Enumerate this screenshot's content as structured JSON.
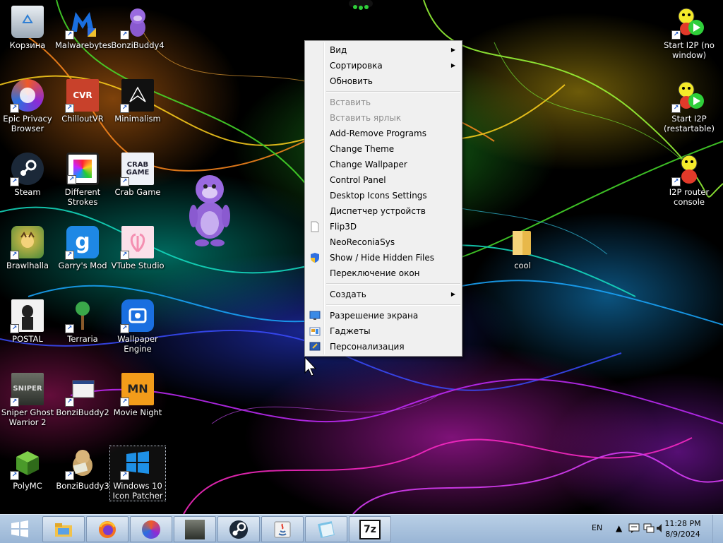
{
  "desktop_icons": [
    {
      "label": "Корзина"
    },
    {
      "label": "Malwarebytes"
    },
    {
      "label": "BonziBuddy4"
    },
    {
      "label": "Epic Privacy Browser"
    },
    {
      "label": "ChilloutVR"
    },
    {
      "label": "Minimalism"
    },
    {
      "label": "Steam"
    },
    {
      "label": "Different Strokes"
    },
    {
      "label": "Crab Game"
    },
    {
      "label": "Brawlhalla"
    },
    {
      "label": "Garry's Mod"
    },
    {
      "label": "VTube Studio"
    },
    {
      "label": "POSTAL"
    },
    {
      "label": "Terraria"
    },
    {
      "label": "Wallpaper Engine"
    },
    {
      "label": "Sniper Ghost Warrior 2"
    },
    {
      "label": "BonziBuddy2"
    },
    {
      "label": "Movie Night"
    },
    {
      "label": "PolyMC"
    },
    {
      "label": "BonziBuddy3"
    },
    {
      "label": "Windows 10 Icon Patcher"
    },
    {
      "label": "Start I2P (no window)"
    },
    {
      "label": "Start I2P (restartable)"
    },
    {
      "label": "I2P router console"
    },
    {
      "label": "cool"
    }
  ],
  "context_menu": {
    "items": [
      {
        "label": "Вид"
      },
      {
        "label": "Сортировка"
      },
      {
        "label": "Обновить"
      },
      {
        "label": "Вставить"
      },
      {
        "label": "Вставить ярлык"
      },
      {
        "label": "Add-Remove Programs"
      },
      {
        "label": "Change Theme"
      },
      {
        "label": "Change Wallpaper"
      },
      {
        "label": "Control Panel"
      },
      {
        "label": "Desktop Icons Settings"
      },
      {
        "label": "Диспетчер устройств"
      },
      {
        "label": "Flip3D"
      },
      {
        "label": "NeoReconiaSys"
      },
      {
        "label": "Show / Hide Hidden Files"
      },
      {
        "label": "Переключение окон"
      },
      {
        "label": "Создать"
      },
      {
        "label": "Разрешение экрана"
      },
      {
        "label": "Гаджеты"
      },
      {
        "label": "Персонализация"
      }
    ]
  },
  "taskbar": {
    "pinned": [
      {
        "icon": "file-explorer-icon"
      },
      {
        "icon": "firefox-icon"
      },
      {
        "icon": "epic-privacy-browser-icon"
      },
      {
        "icon": "sniper-ghost-warrior-icon"
      },
      {
        "icon": "steam-icon"
      },
      {
        "icon": "java-icon"
      },
      {
        "icon": "notepad-icon"
      },
      {
        "icon": "7zip-icon"
      }
    ],
    "tray": {
      "language": "EN",
      "time": "11:28 PM",
      "date": "8/9/2024"
    }
  },
  "colors": {
    "taskbar_top": "#b9cfe6",
    "taskbar_bottom": "#99b5d5",
    "menu_bg": "#f0f0f0",
    "menu_disabled": "#8d8d8d"
  }
}
